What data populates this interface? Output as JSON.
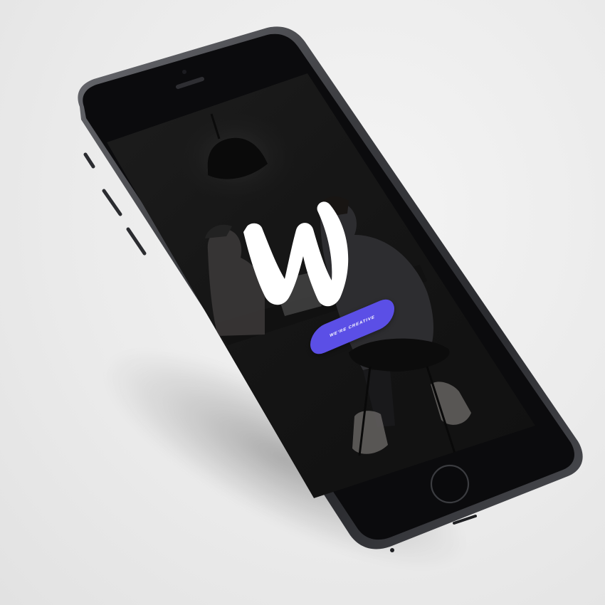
{
  "app": {
    "logo_letter": "W",
    "cta_label": "WE'RE CREATIVE"
  },
  "colors": {
    "background": "#ebebeb",
    "device_body": "#0c0c0e",
    "device_frame": "#3a3b3f",
    "screen_bg": "#1b1b1b",
    "accent": "#5b4fe6",
    "logo": "#ffffff"
  },
  "icons": {
    "home": "home-button-icon",
    "speaker": "earpiece-icon",
    "camera": "front-camera-icon"
  }
}
